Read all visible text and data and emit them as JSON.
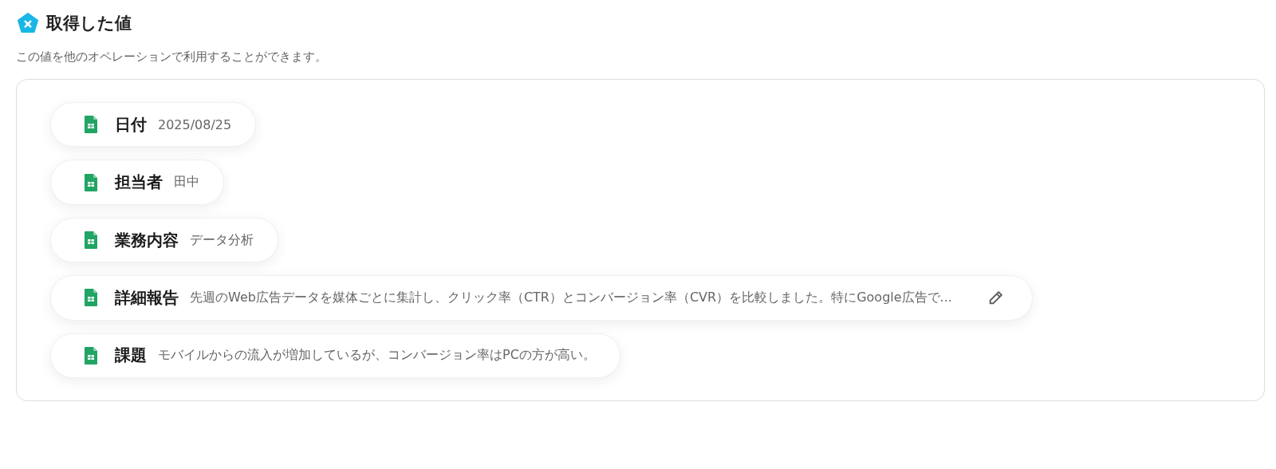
{
  "header": {
    "title": "取得した値",
    "description": "この値を他のオペレーションで利用することができます。"
  },
  "values": [
    {
      "label": "日付",
      "value": "2025/08/25",
      "editable": false
    },
    {
      "label": "担当者",
      "value": "田中",
      "editable": false
    },
    {
      "label": "業務内容",
      "value": "データ分析",
      "editable": false
    },
    {
      "label": "詳細報告",
      "value": "先週のWeb広告データを媒体ごとに集計し、クリック率（CTR）とコンバージョン率（CVR）を比較しました。特にGoogle広告で...",
      "editable": true
    },
    {
      "label": "課題",
      "value": "モバイルからの流入が増加しているが、コンバージョン率はPCの方が高い。",
      "editable": false
    }
  ]
}
